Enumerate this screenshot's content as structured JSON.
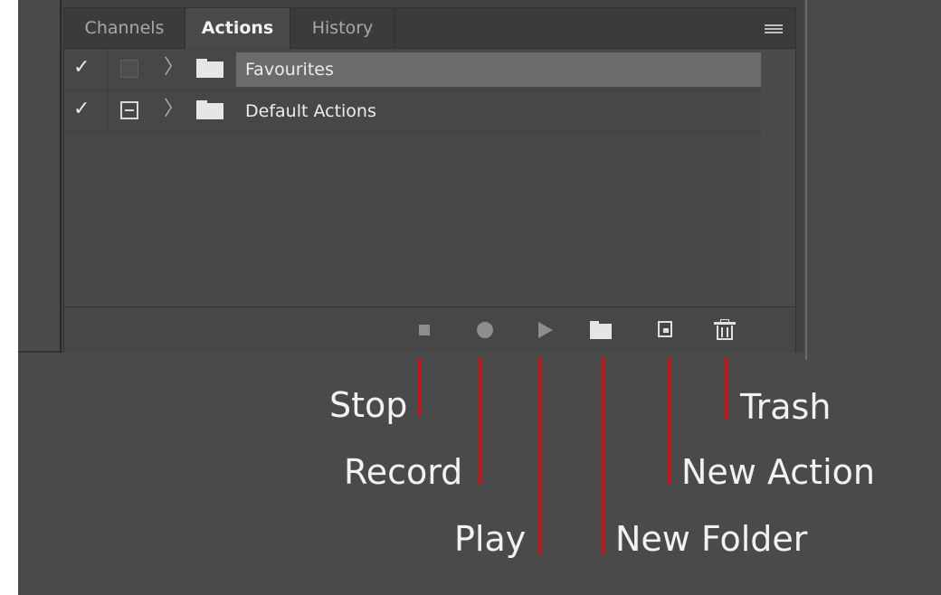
{
  "panel": {
    "tabs": [
      {
        "label": "Channels"
      },
      {
        "label": "Actions"
      },
      {
        "label": "History"
      }
    ],
    "rows": [
      {
        "checked": "✓",
        "chevron": "〉",
        "name": "Favourites"
      },
      {
        "checked": "✓",
        "chevron": "〉",
        "name": "Default Actions"
      }
    ]
  },
  "footer_icons": {
    "stop": "stop-icon",
    "record": "record-icon",
    "play": "play-icon",
    "new_folder": "folder-icon",
    "new_action": "new-action-icon",
    "trash": "trash-icon"
  },
  "callouts": {
    "stop": "Stop",
    "record": "Record",
    "play": "Play",
    "new_folder": "New Folder",
    "new_action": "New Action",
    "trash": "Trash"
  },
  "colors": {
    "callout_line": "#bf1a1a",
    "background": "#4a4a4a"
  }
}
